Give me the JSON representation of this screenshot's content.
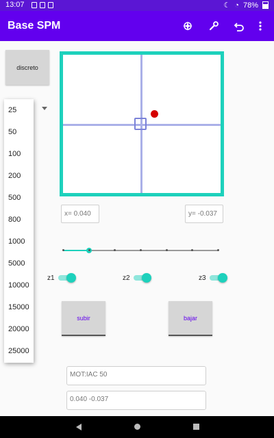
{
  "status_bar": {
    "time": "13:07",
    "battery": "78%"
  },
  "app_bar": {
    "title": "Base SPM",
    "icons": [
      "compass-icon",
      "wrench-icon",
      "undo-icon",
      "more-vert-icon"
    ]
  },
  "controls": {
    "discreto_label": "discreto"
  },
  "step_dropdown": {
    "options": [
      "25",
      "50",
      "100",
      "200",
      "500",
      "800",
      "1000",
      "5000",
      "10000",
      "15000",
      "20000",
      "25000"
    ]
  },
  "position": {
    "x_label": "x= 0.040",
    "y_label": "y= -0.037"
  },
  "slider": {
    "value_fraction": 0.17,
    "ticks": 7
  },
  "z_switches": [
    {
      "label": "z1",
      "on": true
    },
    {
      "label": "z2",
      "on": true
    },
    {
      "label": "z3",
      "on": true
    }
  ],
  "buttons": {
    "up_label": "subir",
    "down_label": "bajar"
  },
  "output": {
    "line1": "MOT:IAC 50",
    "line2": "0.040 -0.037"
  },
  "colors": {
    "primary": "#6200ee",
    "accent": "#1dd1bc",
    "probe": "#d50000"
  }
}
